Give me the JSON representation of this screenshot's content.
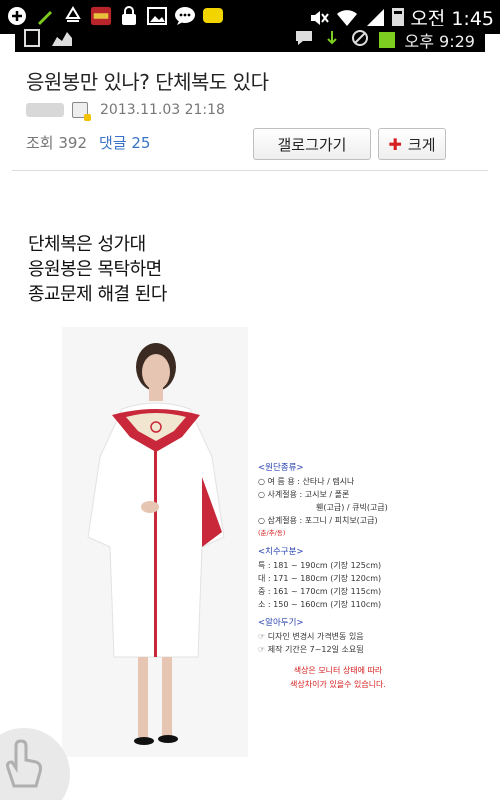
{
  "status_bar": {
    "time": "오전 1:45",
    "icons": [
      "add-icon",
      "pencil-icon",
      "recycle-icon",
      "app-badge-icon",
      "lock-icon",
      "image-icon",
      "chat-bubble-icon",
      "talk-icon",
      "mute-icon",
      "wifi-icon",
      "signal-icon",
      "battery-icon"
    ],
    "app_badge_label": "포켓몬"
  },
  "sub_bar": {
    "time": "오후 9:29"
  },
  "post": {
    "title": "응원봉만 있나? 단체복도 있다",
    "date": "2013.11.03 21:18",
    "views_label": "조회 392",
    "comments_label": "댓글 25",
    "gallery_button": "갤로그가기",
    "big_button": "크게"
  },
  "body": {
    "lines": [
      "단체복은 성가대",
      "응원봉은 목탁하면",
      "종교문제 해결 된다"
    ]
  },
  "spec": {
    "section1": "<원단종류>",
    "line1": "○ 여 름 용 : 산타나 / 렙시나",
    "line2": "○ 사계절용 : 고시보 / 폴론",
    "line3": "휀(고급) / 큐빅(고급)",
    "line4": "○ 삼계절용 : 포그니 / 피치보(고급)",
    "line4_note": "(춘/추/동)",
    "section2": "<치수구분>",
    "size1": "특 : 181 ~ 190cm (기장 125cm)",
    "size2": "대 : 171 ~ 180cm (기장 120cm)",
    "size3": "중 : 161 ~ 170cm (기장 115cm)",
    "size4": "소 : 150 ~ 160cm (기장 110cm)",
    "section3": "<알아두기>",
    "note1": "☞ 디자인 변경시 가격변동 있음",
    "note2": "☞ 제작 기간은 7~12일 소요됨",
    "warn1": "색상은 모니터 상태에 따라",
    "warn2": "색상차이가 있을수 있습니다."
  },
  "colors": {
    "accent_blue": "#3a73c5",
    "red": "#d62020",
    "robe_red": "#c8283a"
  }
}
